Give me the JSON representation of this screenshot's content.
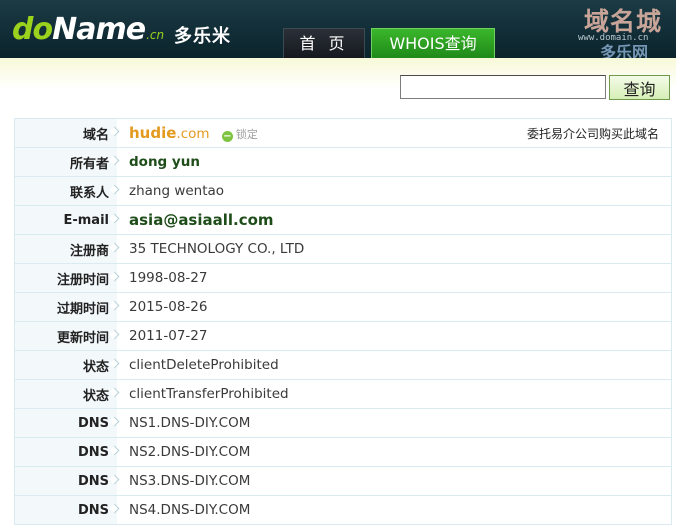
{
  "header": {
    "logo_prefix": "do",
    "logo_main": "Name",
    "logo_suffix": ".cn",
    "logo_chinese": "多乐米",
    "nav": [
      {
        "label": "首 页",
        "active": false
      },
      {
        "label": "WHOIS查询",
        "active": true
      }
    ],
    "watermark": {
      "title": "域名城",
      "url": "www.domain.cn",
      "subtitle": "多乐网"
    }
  },
  "search": {
    "value": "",
    "button_label": "查询"
  },
  "domain": {
    "name": "hudie",
    "tld": ".com",
    "lock_label": "锁定",
    "entrust_link": "委托易介公司购买此域名"
  },
  "rows": [
    {
      "label": "域名"
    },
    {
      "label": "所有者",
      "value": "dong yun"
    },
    {
      "label": "联系人",
      "value": "zhang wentao"
    },
    {
      "label": "E-mail",
      "value": "asia@asiaall.com"
    },
    {
      "label": "注册商",
      "value": "35 TECHNOLOGY CO., LTD"
    },
    {
      "label": "注册时间",
      "value": "1998-08-27"
    },
    {
      "label": "过期时间",
      "value": "2015-08-26"
    },
    {
      "label": "更新时间",
      "value": "2011-07-27"
    },
    {
      "label": "状态",
      "value": "clientDeleteProhibited"
    },
    {
      "label": "状态",
      "value": "clientTransferProhibited"
    },
    {
      "label": "DNS",
      "value": "NS1.DNS-DIY.COM"
    },
    {
      "label": "DNS",
      "value": "NS2.DNS-DIY.COM"
    },
    {
      "label": "DNS",
      "value": "NS3.DNS-DIY.COM"
    },
    {
      "label": "DNS",
      "value": "NS4.DNS-DIY.COM"
    }
  ],
  "colors": {
    "header_bg": "#0f2a33",
    "accent_green": "#1f8a18",
    "domain_orange": "#e39a1d",
    "value_dark_green": "#1f4d1a"
  }
}
